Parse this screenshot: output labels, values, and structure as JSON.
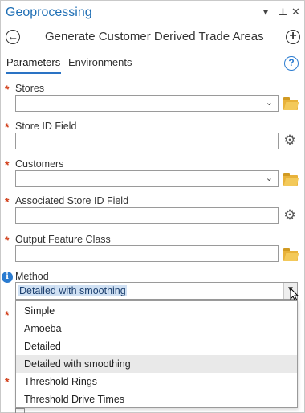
{
  "pane": {
    "title": "Geoprocessing",
    "controls": {
      "menu_glyph": "▾",
      "pin_glyph": "⊥",
      "close_glyph": "✕"
    }
  },
  "tool": {
    "back_glyph": "←",
    "add_glyph": "+",
    "title": "Generate Customer Derived Trade Areas"
  },
  "tabs": [
    {
      "label": "Parameters",
      "active": true
    },
    {
      "label": "Environments",
      "active": false
    }
  ],
  "help_glyph": "?",
  "params": [
    {
      "label": "Stores",
      "required": true,
      "type": "dropdown",
      "value": "",
      "action_icon": "folder-icon"
    },
    {
      "label": "Store ID Field",
      "required": true,
      "type": "text",
      "value": "",
      "action_icon": "gear-icon"
    },
    {
      "label": "Customers",
      "required": true,
      "type": "dropdown",
      "value": "",
      "action_icon": "folder-icon"
    },
    {
      "label": "Associated Store ID Field",
      "required": true,
      "type": "text",
      "value": "",
      "action_icon": "gear-icon"
    },
    {
      "label": "Output Feature Class",
      "required": true,
      "type": "text",
      "value": "",
      "action_icon": "folder-icon"
    }
  ],
  "method": {
    "label": "Method",
    "selected": "Detailed with smoothing",
    "options": [
      "Simple",
      "Amoeba",
      "Detailed",
      "Detailed with smoothing",
      "Threshold Rings",
      "Threshold Drive Times"
    ],
    "hovered_index": 3
  },
  "colors": {
    "accent": "#1f6fb5",
    "required": "#d2401b",
    "selection": "#cfe0f3"
  }
}
